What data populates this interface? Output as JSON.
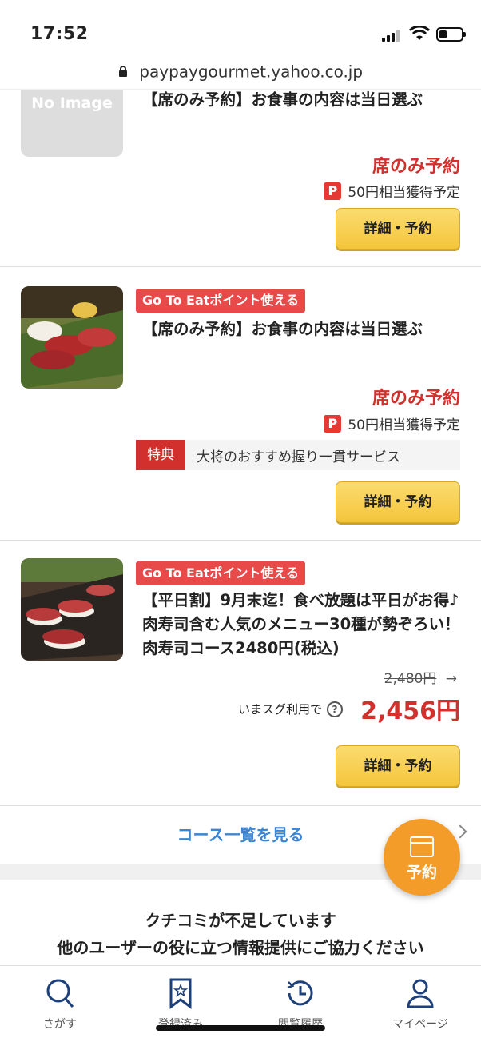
{
  "status_bar": {
    "time": "17:52"
  },
  "browser": {
    "url": "paypaygourmet.yahoo.co.jp"
  },
  "cards": [
    {
      "no_image_text": "No Image",
      "title": "【席のみ予約】お食事の内容は当日選ぶ",
      "price_type": "席のみ予約",
      "points": "50円相当獲得予定",
      "button": "詳細・予約"
    },
    {
      "badge": "Go To Eatポイント使える",
      "title": "【席のみ予約】お食事の内容は当日選ぶ",
      "price_type": "席のみ予約",
      "points": "50円相当獲得予定",
      "perk_tag": "特典",
      "perk_text": "大将のおすすめ握り一貫サービス",
      "button": "詳細・予約"
    },
    {
      "badge": "Go To Eatポイント使える",
      "title": "【平日割】9月末迄！食べ放題は平日がお得♪肉寿司含む人気のメニュー30種が勢ぞろい！肉寿司コース2480円(税込)",
      "old_price": "2,480円",
      "arrow": "→",
      "now_label": "いまスグ利用で",
      "now_price": "2,456円",
      "button": "詳細・予約"
    }
  ],
  "course_list_link": "コース一覧を見る",
  "review": {
    "line1": "クチコミが不足しています",
    "line2": "他のユーザーの役に立つ情報提供にご協力ください"
  },
  "fab": {
    "label": "予約"
  },
  "bottom_nav": [
    {
      "label": "さがす"
    },
    {
      "label": "登録済み"
    },
    {
      "label": "閲覧履歴"
    },
    {
      "label": "マイページ"
    }
  ],
  "colors": {
    "accent_red": "#d2302c",
    "badge_red": "#e84a4a",
    "link_blue": "#3a86d4",
    "button_yellow": "#f4c53b",
    "fab_orange": "#f39c2a",
    "nav_icon_blue": "#1d3f7a"
  }
}
